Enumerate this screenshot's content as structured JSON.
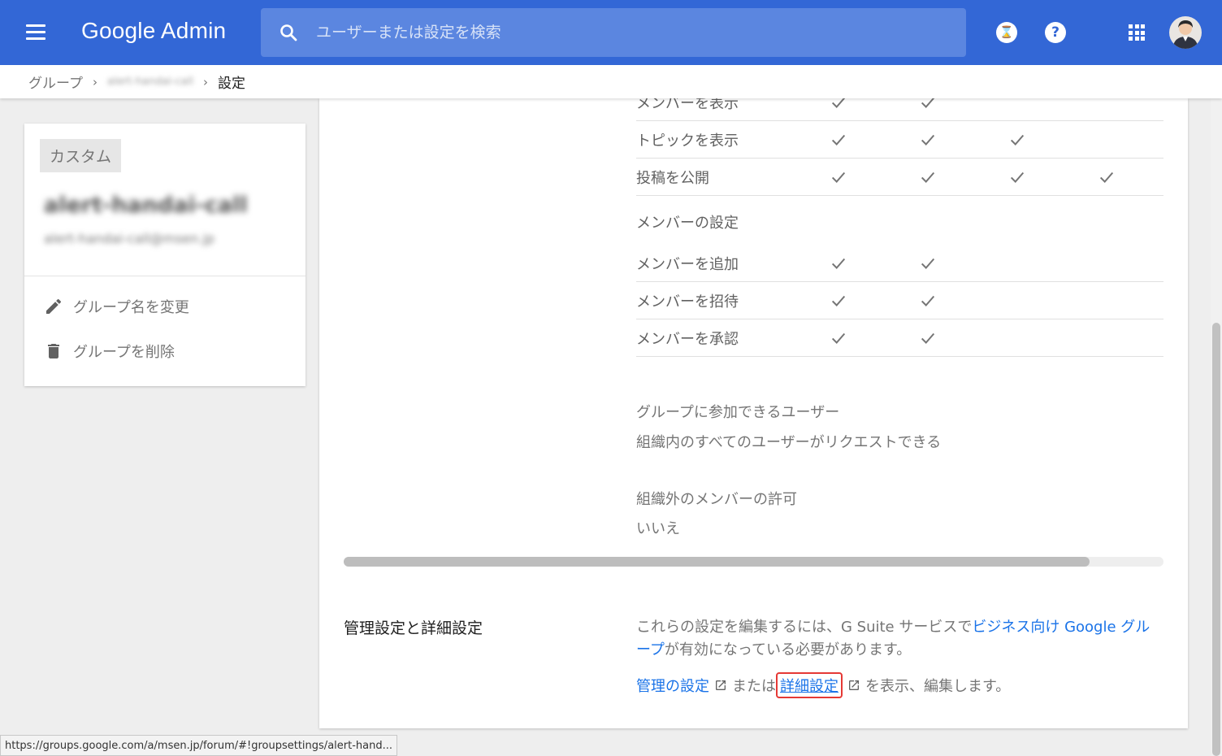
{
  "header": {
    "brand": "Google Admin",
    "search_placeholder": "ユーザーまたは設定を検索",
    "hourglass_glyph": "⌛",
    "help_glyph": "?"
  },
  "breadcrumb": {
    "groups": "グループ",
    "group_name": "alert-handai-call",
    "current": "設定"
  },
  "group_card": {
    "chip": "カスタム",
    "name": "alert-handai-call",
    "email": "alert-handai-call@msen.jp",
    "rename_label": "グループ名を変更",
    "delete_label": "グループを削除"
  },
  "permissions": {
    "rows": [
      {
        "label": "メンバーを表示",
        "checks": [
          true,
          true,
          false,
          false
        ]
      },
      {
        "label": "トピックを表示",
        "checks": [
          true,
          true,
          true,
          false
        ]
      },
      {
        "label": "投稿を公開",
        "checks": [
          true,
          true,
          true,
          true
        ]
      }
    ],
    "member_section_title": "メンバーの設定",
    "member_rows": [
      {
        "label": "メンバーを追加",
        "checks": [
          true,
          true,
          false,
          false
        ]
      },
      {
        "label": "メンバーを招待",
        "checks": [
          true,
          true,
          false,
          false
        ]
      },
      {
        "label": "メンバーを承認",
        "checks": [
          true,
          true,
          false,
          false
        ]
      }
    ]
  },
  "join": {
    "label": "グループに参加できるユーザー",
    "value": "組織内のすべてのユーザーがリクエストできる"
  },
  "external": {
    "label": "組織外のメンバーの許可",
    "value": "いいえ"
  },
  "horizontal_scroll": {
    "thumb_fraction": 0.91
  },
  "admin": {
    "title": "管理設定と詳細設定",
    "desc_prefix": "これらの設定を編集するには、G Suite サービスで",
    "desc_link": "ビジネス向け Google グループ",
    "desc_suffix": "が有効になっている必要があります。",
    "manage_link": "管理の設定",
    "or_text": "または",
    "advanced_link": "詳細設定",
    "tail_text": "を表示、編集します。"
  },
  "status_url": "https://groups.google.com/a/msen.jp/forum/#!groupsettings/alert-hand..."
}
